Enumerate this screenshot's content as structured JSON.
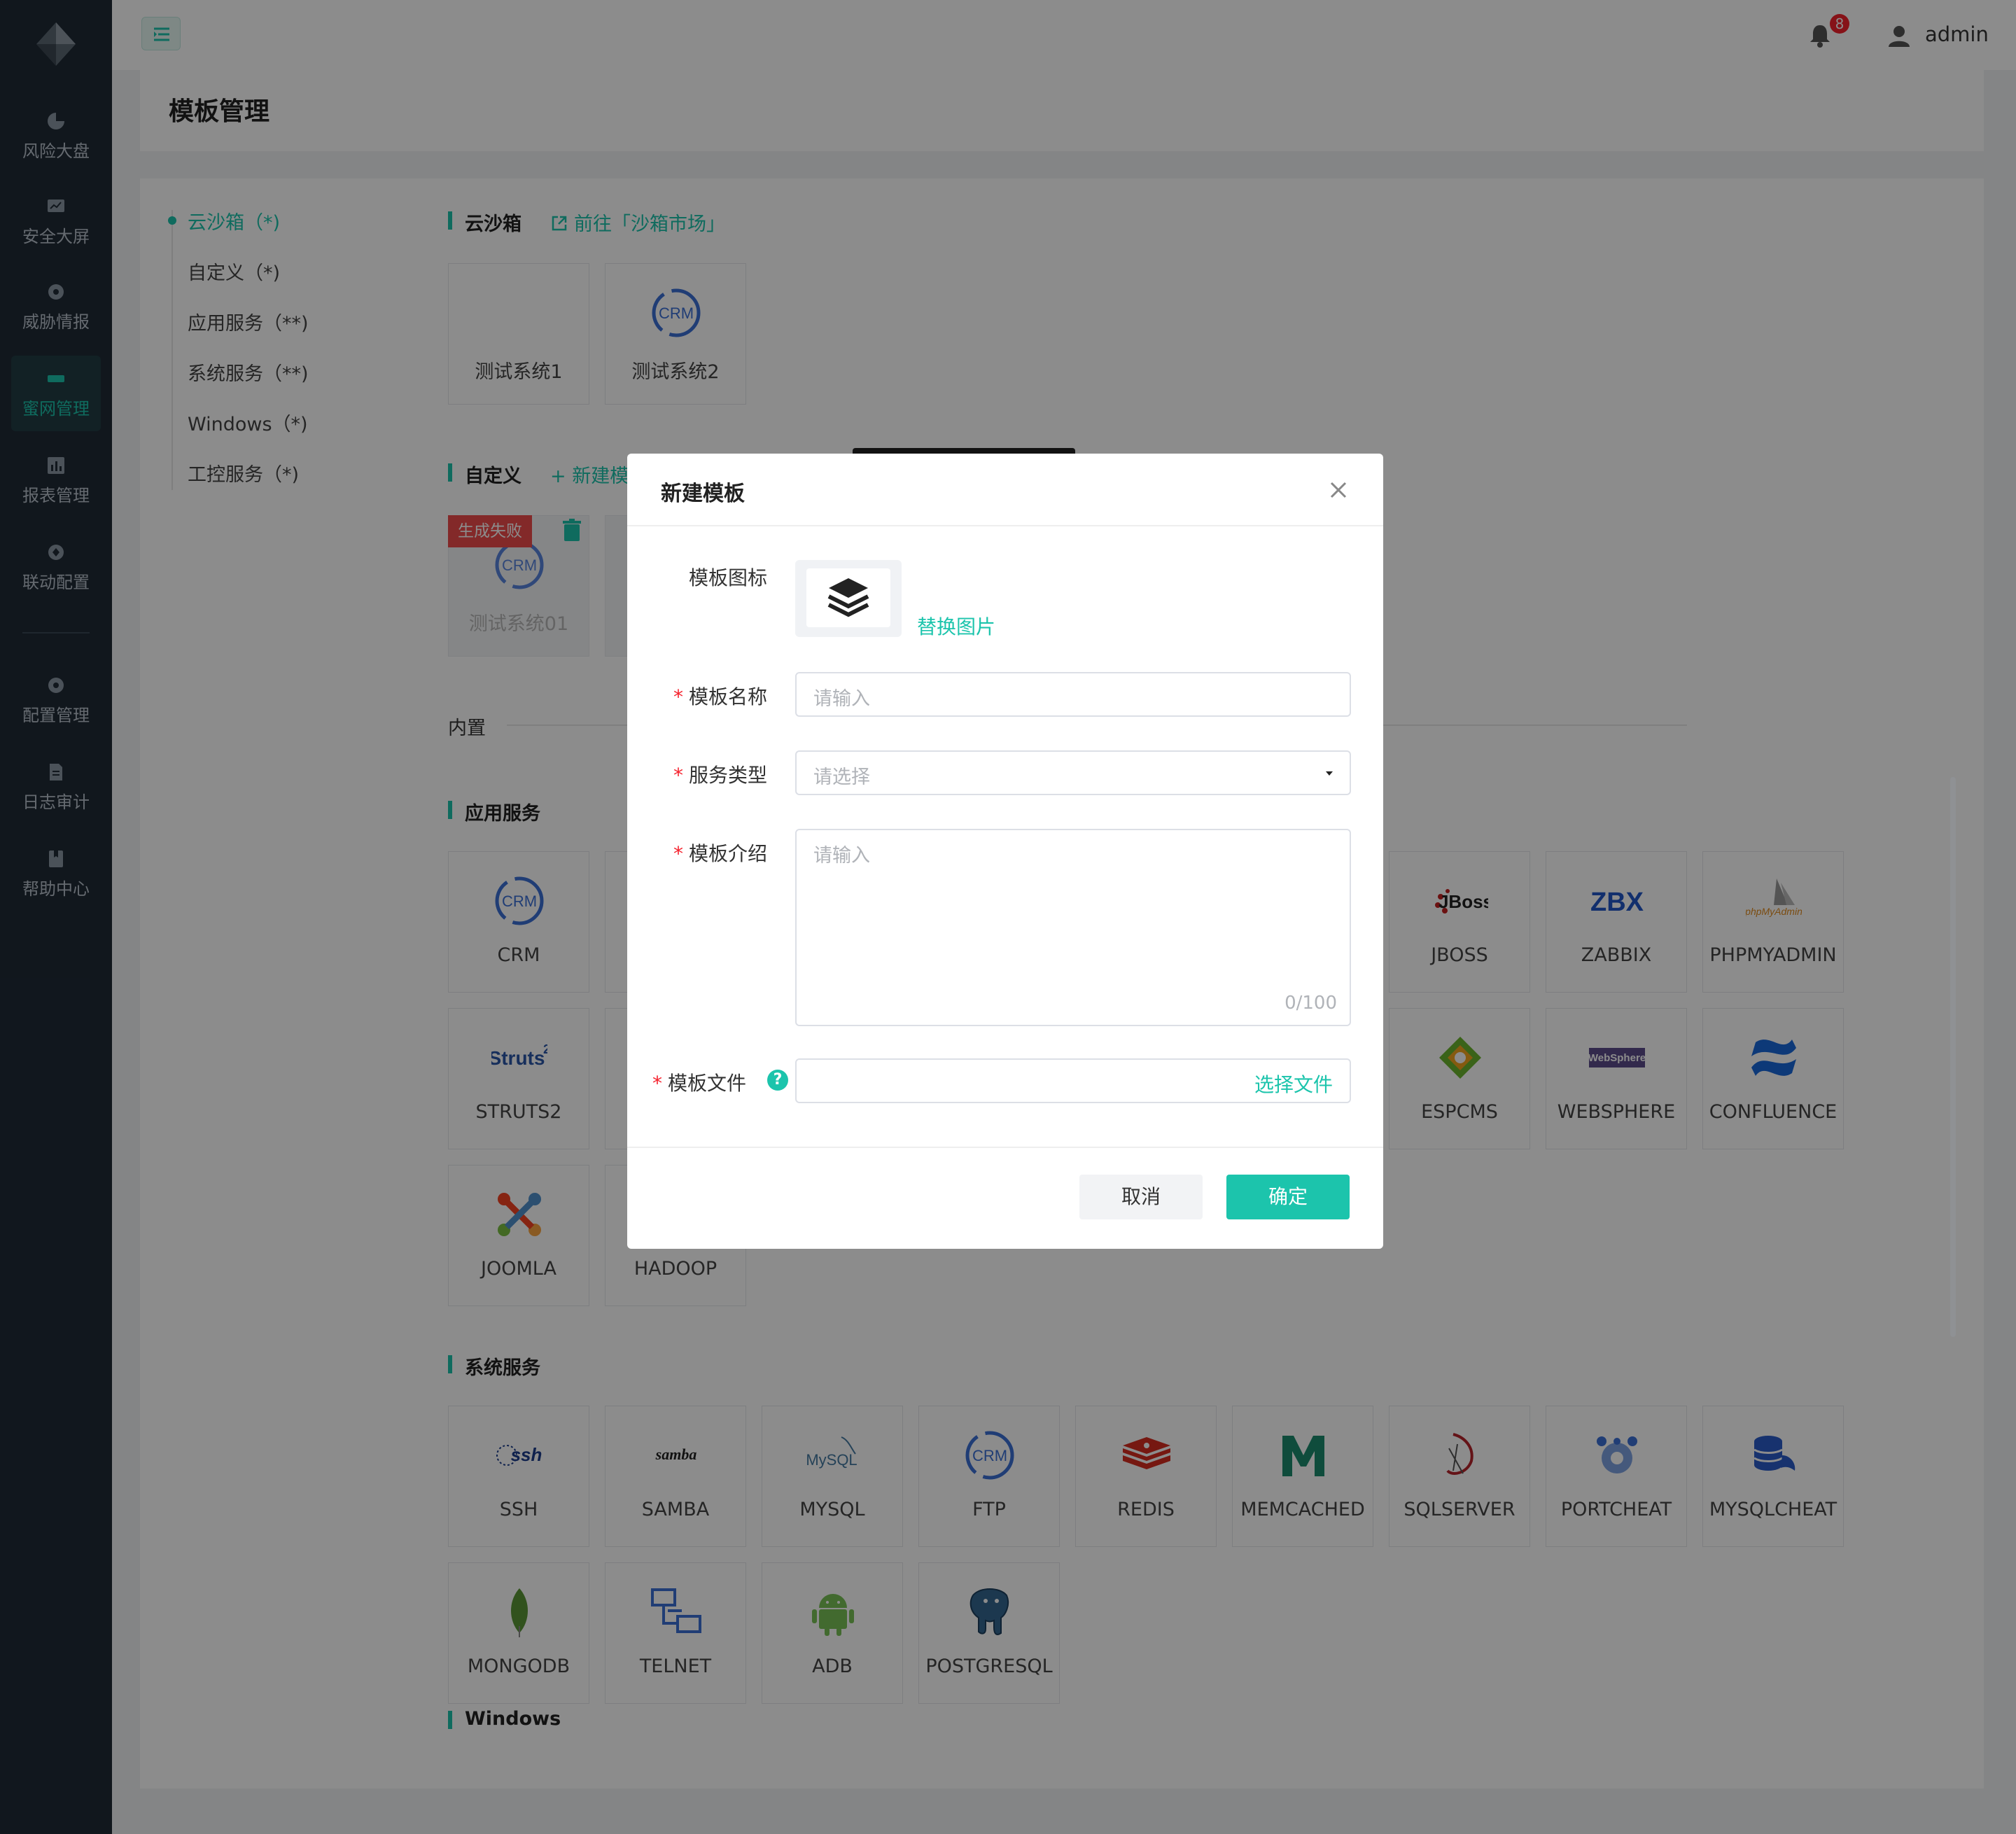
{
  "sidebar": {
    "items": [
      {
        "label": "风险大盘",
        "icon": "dashboard-icon"
      },
      {
        "label": "安全大屏",
        "icon": "screen-icon"
      },
      {
        "label": "威胁情报",
        "icon": "intel-icon"
      },
      {
        "label": "蜜网管理",
        "icon": "honeynet-icon",
        "active": true
      },
      {
        "label": "报表管理",
        "icon": "report-icon"
      },
      {
        "label": "联动配置",
        "icon": "link-icon"
      },
      {
        "label": "配置管理",
        "icon": "config-icon"
      },
      {
        "label": "日志审计",
        "icon": "log-icon"
      },
      {
        "label": "帮助中心",
        "icon": "help-icon"
      }
    ]
  },
  "header": {
    "notification_count": "8",
    "username": "admin"
  },
  "page": {
    "title": "模板管理"
  },
  "anchors": [
    "云沙箱（*)",
    "自定义（*)",
    "应用服务（**)",
    "系统服务（**)",
    "Windows（*)",
    "工控服务（*)"
  ],
  "sections": {
    "sandbox": {
      "title": "云沙箱",
      "link": "前往「沙箱市场」",
      "cards": [
        "测试系统1",
        "测试系统2"
      ]
    },
    "custom": {
      "title": "自定义",
      "add": "+ 新建模",
      "cards": [
        {
          "label": "测试系统01",
          "badge": "生成失败"
        }
      ]
    },
    "builtin": "内置",
    "app": {
      "title": "应用服务",
      "cards": [
        "CRM",
        "JBOSS",
        "ZABBIX",
        "PHPMYADMIN",
        "STRUTS2",
        "ESPCMS",
        "WEBSPHERE",
        "CONFLUENCE",
        "JOOMLA",
        "HADOOP"
      ]
    },
    "sys": {
      "title": "系统服务",
      "cards": [
        "SSH",
        "SAMBA",
        "MYSQL",
        "FTP",
        "REDIS",
        "MEMCACHED",
        "SQLSERVER",
        "PORTCHEAT",
        "MYSQLCHEAT",
        "MONGODB",
        "TELNET",
        "ADB",
        "POSTGRESQL"
      ]
    },
    "windows": {
      "title": "Windows"
    }
  },
  "modal": {
    "title": "新建模板",
    "icon_label": "模板图标",
    "replace_image": "替换图片",
    "name_label": "模板名称",
    "name_placeholder": "请输入",
    "type_label": "服务类型",
    "type_placeholder": "请选择",
    "intro_label": "模板介绍",
    "intro_placeholder": "请输入",
    "intro_counter": "0/100",
    "file_label": "模板文件",
    "choose_file": "选择文件",
    "cancel": "取消",
    "ok": "确定"
  },
  "colors": {
    "accent": "#1cc4ac",
    "sidebar": "#1f2a36",
    "danger": "#ef4b4b"
  },
  "icon_text": {
    "crm": "CRM",
    "struts": "Struts",
    "zbx": "ZBX",
    "jboss": "JBoss",
    "websphere": "WebSphere",
    "phpmyadmin": "phpMyAdmin",
    "ssh": "ssh",
    "samba": "samba",
    "mysql": "MySQL"
  }
}
